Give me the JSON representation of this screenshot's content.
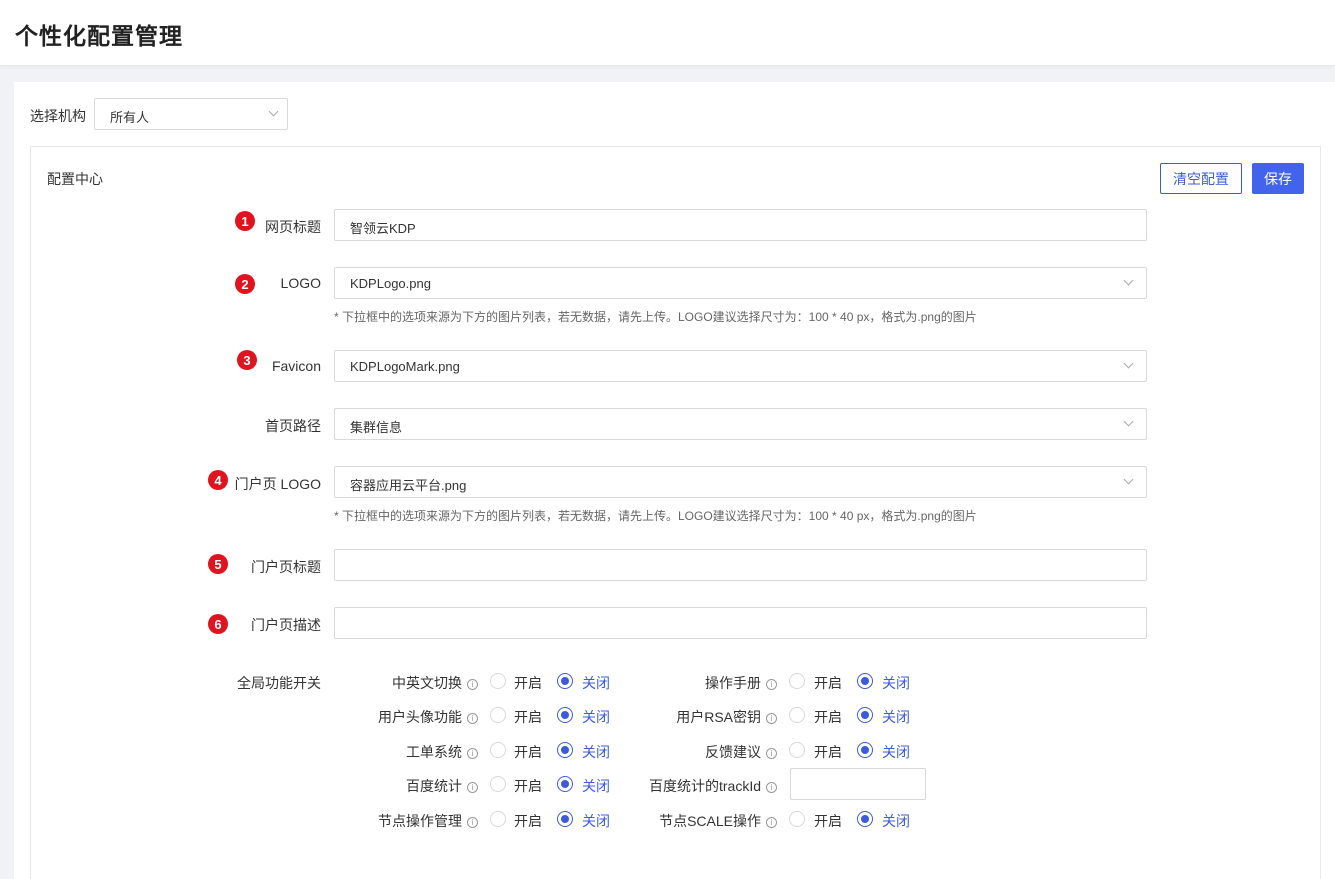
{
  "page_title": "个性化配置管理",
  "org": {
    "label": "选择机构",
    "value": "所有人"
  },
  "panel": {
    "title": "配置中心",
    "clear_label": "清空配置",
    "save_label": "保存"
  },
  "fields": {
    "web_title": {
      "badge": "1",
      "label": "网页标题",
      "value": "智领云KDP"
    },
    "logo": {
      "badge": "2",
      "label": "LOGO",
      "value": "KDPLogo.png",
      "hint": "* 下拉框中的选项来源为下方的图片列表，若无数据，请先上传。LOGO建议选择尺寸为：100 * 40 px，格式为.png的图片"
    },
    "favicon": {
      "badge": "3",
      "label": "Favicon",
      "value": "KDPLogoMark.png"
    },
    "home_path": {
      "label": "首页路径",
      "value": "集群信息"
    },
    "portal_logo": {
      "badge": "4",
      "label": "门户页 LOGO",
      "value": "容器应用云平台.png",
      "hint": "* 下拉框中的选项来源为下方的图片列表，若无数据，请先上传。LOGO建议选择尺寸为：100 * 40 px，格式为.png的图片"
    },
    "portal_title": {
      "badge": "5",
      "label": "门户页标题",
      "value": ""
    },
    "portal_desc": {
      "badge": "6",
      "label": "门户页描述",
      "value": ""
    }
  },
  "switches": {
    "group_label": "全局功能开关",
    "on_label": "开启",
    "off_label": "关闭",
    "left": [
      {
        "label": "中英文切换",
        "value": "off"
      },
      {
        "label": "用户头像功能",
        "value": "off"
      },
      {
        "label": "工单系统",
        "value": "off"
      },
      {
        "label": "百度统计",
        "value": "off"
      },
      {
        "label": "节点操作管理",
        "value": "off"
      }
    ],
    "right": [
      {
        "label": "操作手册",
        "value": "off"
      },
      {
        "label": "用户RSA密钥",
        "value": "off"
      },
      {
        "label": "反馈建议",
        "value": "off"
      },
      {
        "label": "百度统计的trackId",
        "value": ""
      },
      {
        "label": "节点SCALE操作",
        "value": "off"
      }
    ]
  },
  "icons": {
    "info": "info-icon",
    "chevron": "chevron-down-icon"
  }
}
